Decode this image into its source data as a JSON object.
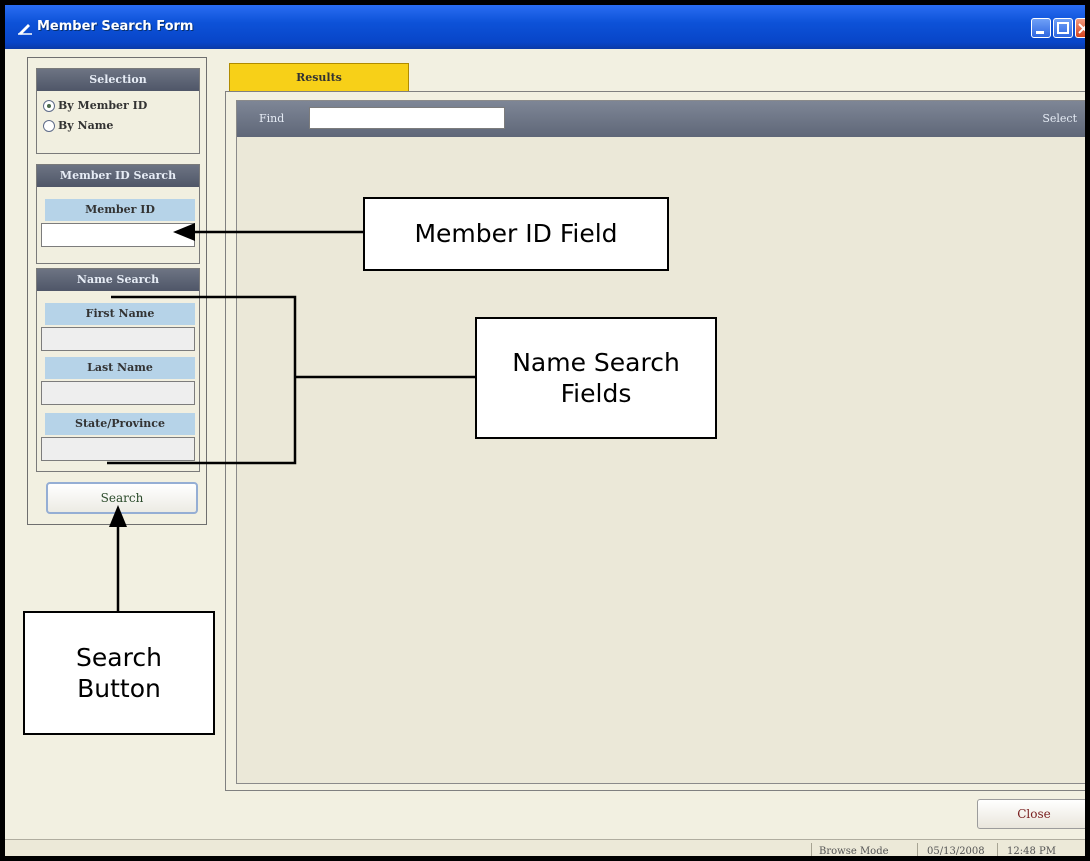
{
  "window": {
    "title": "Member Search Form",
    "buttons": [
      "minimize-icon",
      "maximize-icon",
      "close-icon"
    ]
  },
  "left_panel": {
    "selection": {
      "header": "Selection",
      "options": [
        {
          "label": "By Member ID",
          "selected": true
        },
        {
          "label": "By Name",
          "selected": false
        }
      ]
    },
    "member_id_search": {
      "header": "Member ID Search",
      "field_label": "Member ID",
      "field_value": ""
    },
    "name_search": {
      "header": "Name Search",
      "fields": [
        {
          "label": "First Name",
          "value": ""
        },
        {
          "label": "Last Name",
          "value": ""
        },
        {
          "label": "State/Province",
          "value": ""
        }
      ]
    },
    "search_button": "Search"
  },
  "results": {
    "tab_label": "Results",
    "find_label": "Find",
    "find_value": "",
    "select_label": "Select"
  },
  "close_button": "Close",
  "status": {
    "mode": "Browse Mode",
    "date": "05/13/2008",
    "time": "12:48 PM"
  },
  "callouts": {
    "member_id": "Member ID Field",
    "name_search": [
      "Name Search",
      "Fields"
    ],
    "search": [
      "Search",
      "Button"
    ]
  },
  "colors": {
    "titlebar": "#0d52d8",
    "tab_active": "#f7d018",
    "group_header": "#5f6778",
    "field_label_bg": "#b6d3e8",
    "window_bg": "#f2f0e1"
  }
}
